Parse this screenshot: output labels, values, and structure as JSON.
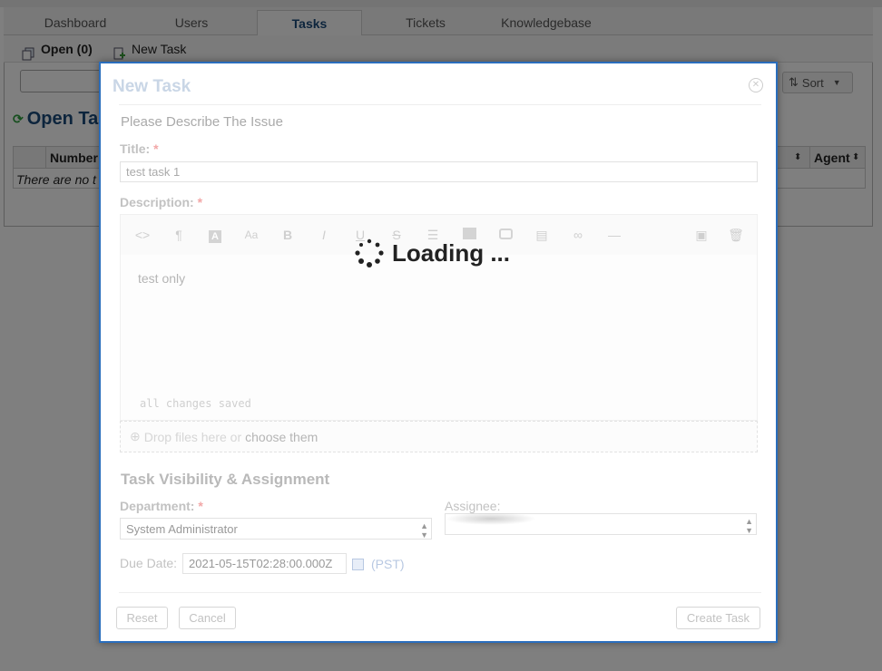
{
  "nav": {
    "tabs": [
      {
        "label": "Dashboard"
      },
      {
        "label": "Users"
      },
      {
        "label": "Tasks"
      },
      {
        "label": "Tickets"
      },
      {
        "label": "Knowledgebase"
      }
    ],
    "active_tab": "Tasks"
  },
  "subnav": {
    "open_label": "Open (0)",
    "new_task_label": "New Task"
  },
  "list": {
    "sort_label": "Sort",
    "title_partial": "Open Ta",
    "columns": [
      "Number",
      "Agent"
    ],
    "empty_text": "There are no t"
  },
  "modal": {
    "title": "New Task",
    "subtitle": "Please Describe The Issue",
    "title_label": "Title:",
    "title_value": "test task 1",
    "description_label": "Description:",
    "description_text": "test only",
    "editor_status": "all changes saved",
    "drop_text": "Drop files here or",
    "choose_text": "choose them",
    "section_heading": "Task Visibility & Assignment",
    "department_label": "Department:",
    "department_value": "System Administrator",
    "assignee_label": "Assignee:",
    "due_date_label": "Due Date:",
    "due_date_value": "2021-05-15T02:28:00.000Z",
    "timezone": "(PST)",
    "required_mark": "*",
    "reset_label": "Reset",
    "cancel_label": "Cancel",
    "create_label": "Create Task"
  },
  "loading": {
    "text": "Loading ..."
  },
  "colors": {
    "accent": "#2a6ebd",
    "title_blue": "#1a4a7a",
    "refresh_green": "#2e9e3e"
  }
}
